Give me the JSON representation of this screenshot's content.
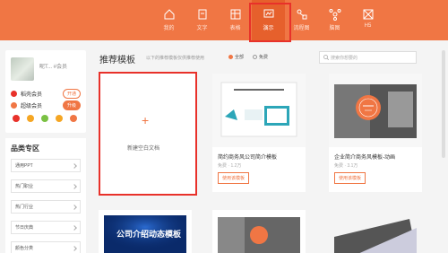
{
  "topbar": {
    "left_text": "我的",
    "nav": [
      {
        "label": "我的",
        "icon": "home-icon"
      },
      {
        "label": "文字",
        "icon": "document-icon"
      },
      {
        "label": "表格",
        "icon": "table-icon"
      },
      {
        "label": "演示",
        "icon": "presentation-icon"
      },
      {
        "label": "流程图",
        "icon": "flowchart-icon"
      },
      {
        "label": "脑图",
        "icon": "mindmap-icon"
      },
      {
        "label": "H5",
        "icon": "h5-icon"
      }
    ]
  },
  "user": {
    "name": "昵T... #会员",
    "member1_label": "稻壳会员",
    "member1_action": "开通",
    "member2_label": "超级会员",
    "member2_action": "升级"
  },
  "categories": {
    "title": "品类专区",
    "items": [
      "通用PPT",
      "热门职业",
      "热门行业",
      "节日庆典",
      "颜色分类"
    ]
  },
  "main": {
    "title": "推荐模板",
    "subtitle": "以下的推荐模板仅供推荐使用",
    "filter_all": "全部",
    "filter_free": "免费",
    "search_placeholder": "搜索你想要的"
  },
  "new_doc": {
    "label": "新建空白文档"
  },
  "templates": [
    {
      "name": "简约商务风公司简介模板",
      "author": "免费",
      "views": "1.2万",
      "use": "使用该模板"
    },
    {
      "name": "企业简介商务风模板-动画",
      "author": "免费",
      "views": "3.1万",
      "use": "使用该模板"
    }
  ],
  "bottom_banner_text": "公司介绍动态模板"
}
